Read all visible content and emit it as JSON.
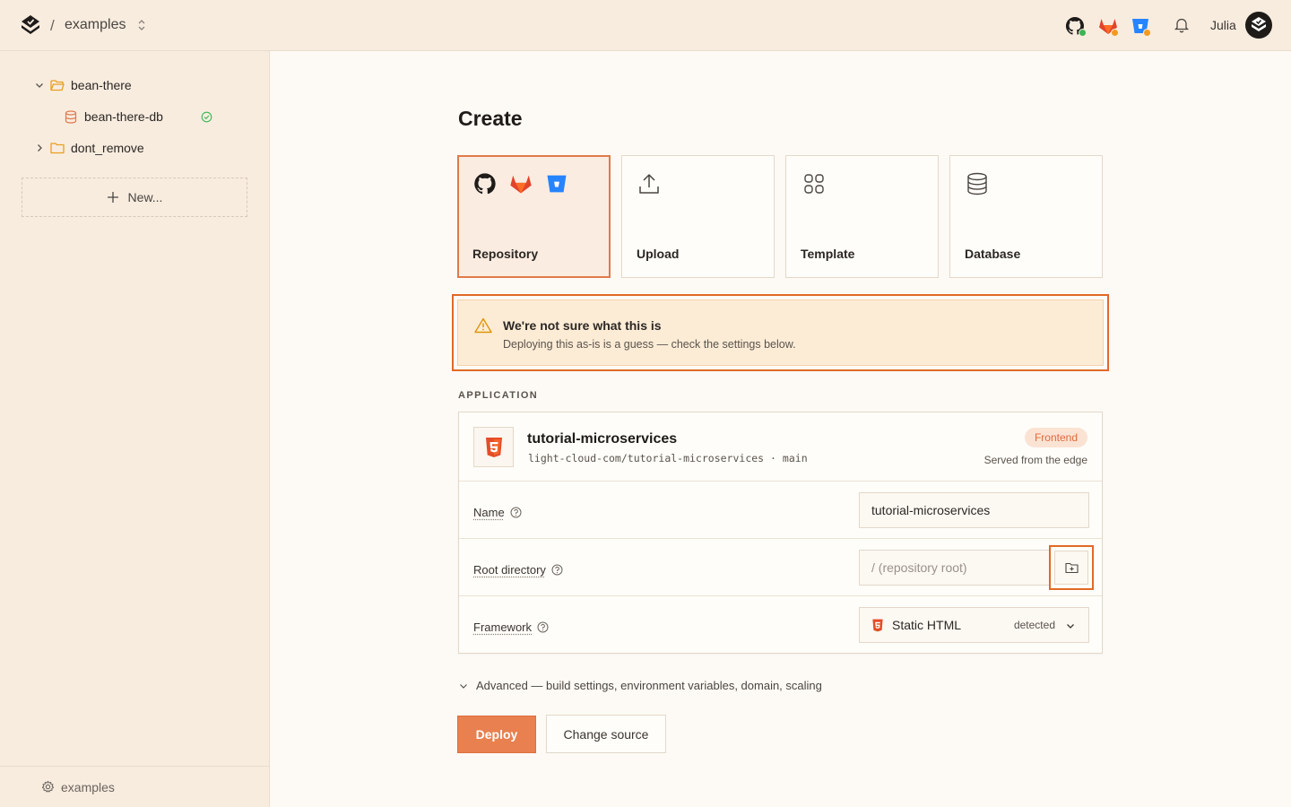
{
  "topbar": {
    "separator": "/",
    "project": "examples",
    "user": "Julia",
    "icons": [
      "github-icon",
      "gitlab-icon",
      "bitbucket-icon",
      "bell-icon"
    ]
  },
  "sidebar": {
    "tree": [
      {
        "label": "bean-there",
        "type": "folder",
        "expanded": true
      },
      {
        "label": "bean-there-db",
        "type": "database",
        "status": "ok"
      },
      {
        "label": "dont_remove",
        "type": "folder",
        "expanded": false
      }
    ],
    "new_label": "New...",
    "footer_label": "examples"
  },
  "main": {
    "title": "Create",
    "cards": [
      {
        "label": "Repository",
        "selected": true
      },
      {
        "label": "Upload",
        "selected": false
      },
      {
        "label": "Template",
        "selected": false
      },
      {
        "label": "Database",
        "selected": false
      }
    ],
    "warning": {
      "title": "We're not sure what this is",
      "text": "Deploying this as-is is a guess — check the settings below."
    },
    "section_label": "APPLICATION",
    "app": {
      "name": "tutorial-microservices",
      "repo": "light-cloud-com/tutorial-microservices",
      "sep": "·",
      "branch": "main",
      "badge": "Frontend",
      "served": "Served from the edge"
    },
    "form": {
      "name_label": "Name",
      "name_value": "tutorial-microservices",
      "root_label": "Root directory",
      "root_placeholder": "/ (repository root)",
      "framework_label": "Framework",
      "framework_value": "Static HTML",
      "framework_status": "detected"
    },
    "advanced": "Advanced — build settings, environment variables, domain, scaling",
    "deploy_label": "Deploy",
    "change_label": "Change source"
  },
  "colors": {
    "accent": "#e8804f",
    "highlight": "#e06a26",
    "warning_bg": "#fcecd6",
    "sidebar_bg": "#f8ecdf"
  }
}
